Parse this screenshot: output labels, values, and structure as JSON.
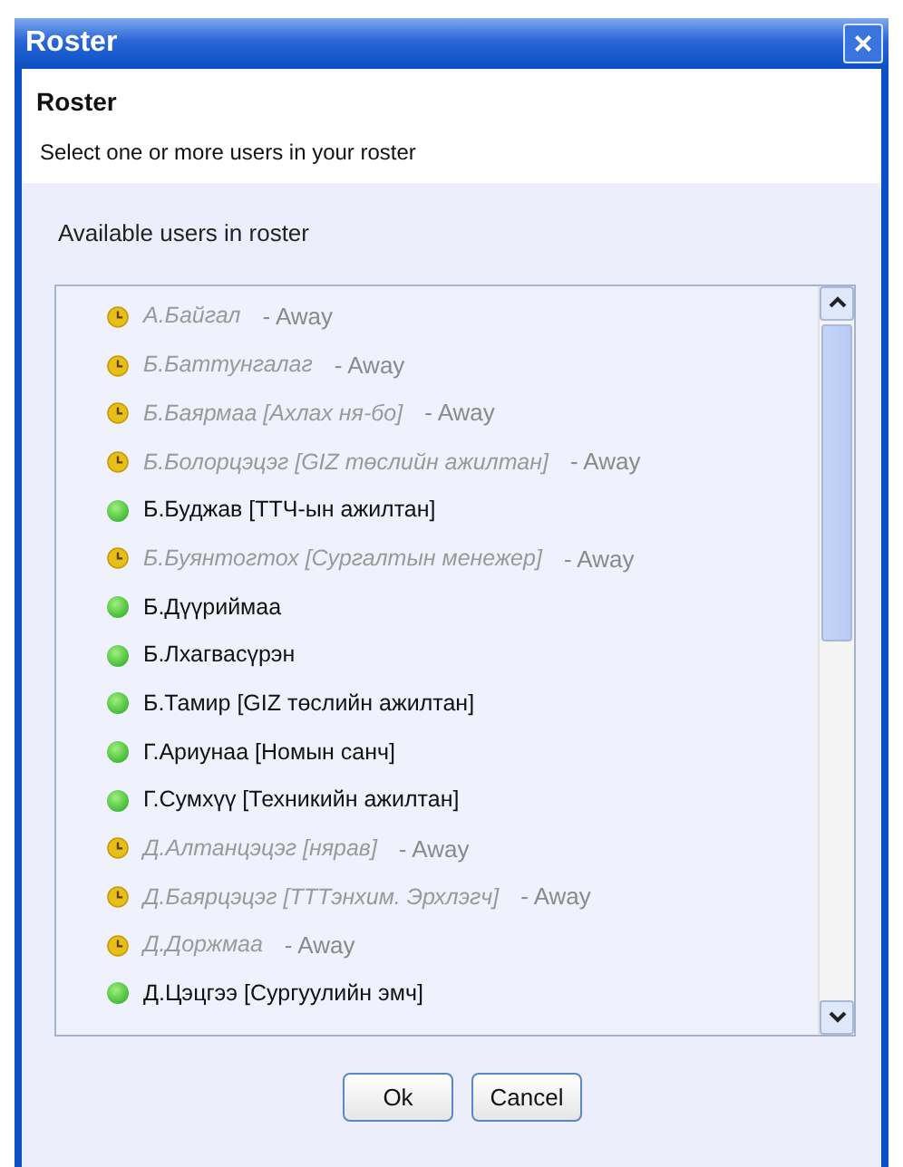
{
  "window": {
    "title": "Roster",
    "close": "×"
  },
  "header": {
    "title": "Roster",
    "subtitle": "Select one or more users in your roster"
  },
  "list_label": "Available users in roster",
  "users": [
    {
      "name": "А.Байгал",
      "kind": "away",
      "status_text": "- Away"
    },
    {
      "name": "Б.Баттунгалаг",
      "kind": "away",
      "status_text": "- Away"
    },
    {
      "name": "Б.Баярмаа [Ахлах ня-бо]",
      "kind": "away",
      "status_text": "- Away"
    },
    {
      "name": "Б.Болорцэцэг [GIZ төслийн ажилтан]",
      "kind": "away",
      "status_text": "- Away"
    },
    {
      "name": "Б.Буджав [ТТЧ-ын ажилтан]",
      "kind": "online"
    },
    {
      "name": "Б.Буянтогтох [Сургалтын менежер]",
      "kind": "away",
      "status_text": "- Away"
    },
    {
      "name": "Б.Дүүриймаа",
      "kind": "online"
    },
    {
      "name": "Б.Лхагвасүрэн",
      "kind": "online"
    },
    {
      "name": "Б.Тамир [GIZ төслийн ажилтан]",
      "kind": "online"
    },
    {
      "name": "Г.Ариунаа [Номын санч]",
      "kind": "online"
    },
    {
      "name": "Г.Сумхүү [Техникийн ажилтан]",
      "kind": "online"
    },
    {
      "name": "Д.Алтанцэцэг [нярав]",
      "kind": "away",
      "status_text": "- Away"
    },
    {
      "name": "Д.Баярцэцэг [ТТТэнхим. Эрхлэгч]",
      "kind": "away",
      "status_text": "- Away"
    },
    {
      "name": "Д.Доржмаа",
      "kind": "away",
      "status_text": "- Away"
    },
    {
      "name": "Д.Цэцгээ [Сургуулийн эмч]",
      "kind": "online"
    }
  ],
  "buttons": [
    "Ok",
    "Cancel"
  ]
}
